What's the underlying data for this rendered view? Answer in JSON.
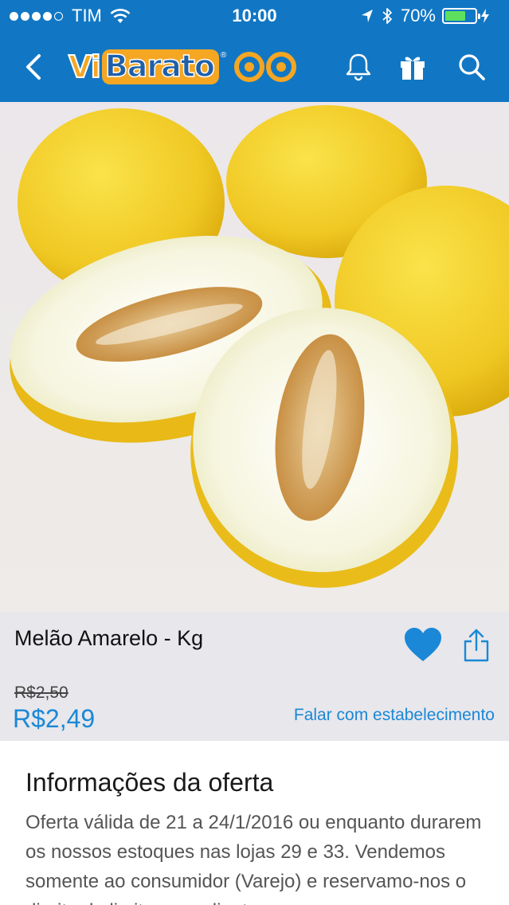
{
  "status_bar": {
    "carrier": "TIM",
    "time": "10:00",
    "battery_text": "70%",
    "battery_level": 0.7,
    "signal_bars": 4,
    "signal_max": 5
  },
  "nav": {
    "brand_vi": "Vi",
    "brand_barato": "Barato",
    "brand_reg": "®",
    "icons": [
      "back-chevron-icon",
      "bell-icon",
      "gift-icon",
      "search-icon"
    ]
  },
  "product": {
    "title": "Melão Amarelo - Kg",
    "old_price": "R$2,50",
    "price": "R$2,49",
    "contact_link": "Falar com estabelecimento",
    "favorite": true
  },
  "offer": {
    "heading": "Informações da oferta",
    "text": "Oferta válida de 21 a 24/1/2016 ou enquanto durarem os nossos estoques nas lojas 29 e 33. Vendemos somente ao consumidor (Varejo) e reservamo-nos o direito de limitar, por cliente"
  },
  "colors": {
    "brand_blue": "#1177c4",
    "accent_orange": "#f5a623",
    "price_blue": "#1a88d6",
    "melon_yellow": "#f2cf2c"
  }
}
